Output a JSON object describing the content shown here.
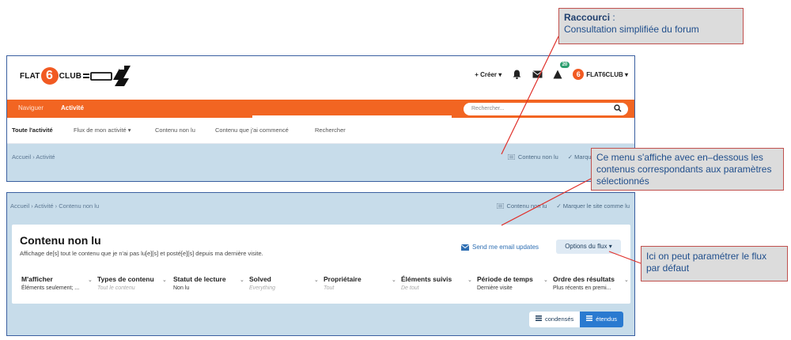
{
  "top_screenshot": {
    "logo_flat": "FLAT",
    "logo_six": "6",
    "logo_club": "CLUB",
    "create_label": "+ Créer ▾",
    "notifications_count": "20",
    "user_avatar_char": "6",
    "user_label": "FLAT6CLUB ▾",
    "nav": {
      "naviguer": "Naviguer",
      "activite": "Activité"
    },
    "search_placeholder": "Rechercher...",
    "subnav": [
      "Toute l'activité",
      "Flux de mon activité ▾",
      "Contenu non lu",
      "Contenu que j'ai commencé",
      "Rechercher"
    ],
    "breadcrumb": "Accueil  ›  Activité",
    "actions": {
      "unread": "Contenu non lu",
      "mark": "✓  Marquer le"
    }
  },
  "bottom_screenshot": {
    "breadcrumb": "Accueil  ›  Activité  ›  Contenu non lu",
    "actions": {
      "unread": "Contenu non lu",
      "mark": "✓  Marquer le site comme lu"
    },
    "title": "Contenu non lu",
    "description": "Affichage de[s] tout le contenu que je n'ai pas lu[e][s] et posté[e][s] depuis ma dernière visite.",
    "email_updates": "Send me email updates",
    "flux_options": "Options du flux ▾",
    "filters": [
      {
        "label": "M'afficher",
        "value": "Éléments seulement; ...",
        "placeholder": false
      },
      {
        "label": "Types de contenu",
        "value": "Tout le contenu",
        "placeholder": true
      },
      {
        "label": "Statut de lecture",
        "value": "Non lu",
        "placeholder": false
      },
      {
        "label": "Solved",
        "value": "Everything",
        "placeholder": true
      },
      {
        "label": "Propriétaire",
        "value": "Tout",
        "placeholder": true
      },
      {
        "label": "Éléments suivis",
        "value": "De tout",
        "placeholder": true
      },
      {
        "label": "Période de temps",
        "value": "Dernière visite",
        "placeholder": false
      },
      {
        "label": "Ordre des résultats",
        "value": "Plus récents en premi...",
        "placeholder": false
      }
    ],
    "view_condensed": "condensés",
    "view_expanded": "étendus"
  },
  "callouts": {
    "shortcut_title": "Raccourci",
    "shortcut_colon": " :",
    "shortcut_text": "Consultation simplifiée du forum",
    "menu_text": "Ce menu s'affiche avec en–dessous les contenus correspondants aux paramètres sélectionnés",
    "default_text": "Ici on peut paramétrer le flux par défaut"
  },
  "colors": {
    "accent_orange": "#f26522",
    "breadcrumb_blue": "#c7dcea",
    "callout_border": "#c0504d",
    "callout_text": "#1f4e8c"
  }
}
